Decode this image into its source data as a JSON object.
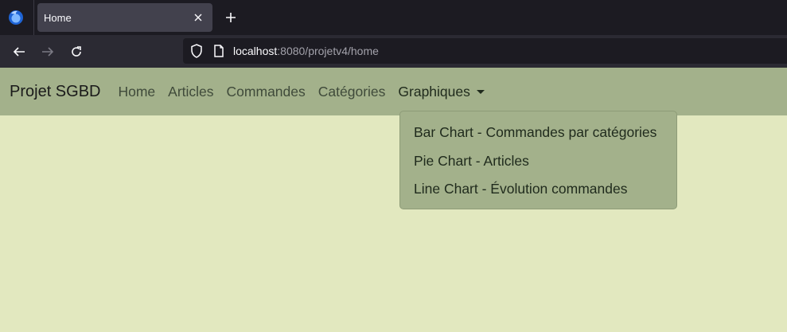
{
  "browser": {
    "tab": {
      "title": "Home"
    },
    "url": {
      "host": "localhost",
      "rest": ":8080/projetv4/home"
    }
  },
  "navbar": {
    "brand": "Projet SGBD",
    "links": [
      {
        "label": "Home"
      },
      {
        "label": "Articles"
      },
      {
        "label": "Commandes"
      },
      {
        "label": "Catégories"
      }
    ],
    "dropdown": {
      "label": "Graphiques",
      "items": [
        {
          "label": "Bar Chart - Commandes par catégories"
        },
        {
          "label": "Pie Chart - Articles"
        },
        {
          "label": "Line Chart - Évolution commandes"
        }
      ]
    }
  },
  "theme": {
    "page_bg": "#e2e8bf",
    "navbar_bg": "#a3b18b",
    "chrome_dark": "#1c1b22"
  },
  "icons": [
    "firefox-icon",
    "close-icon",
    "plus-icon",
    "back-arrow-icon",
    "forward-arrow-icon",
    "reload-icon",
    "shield-icon",
    "page-icon",
    "caret-down-icon"
  ]
}
